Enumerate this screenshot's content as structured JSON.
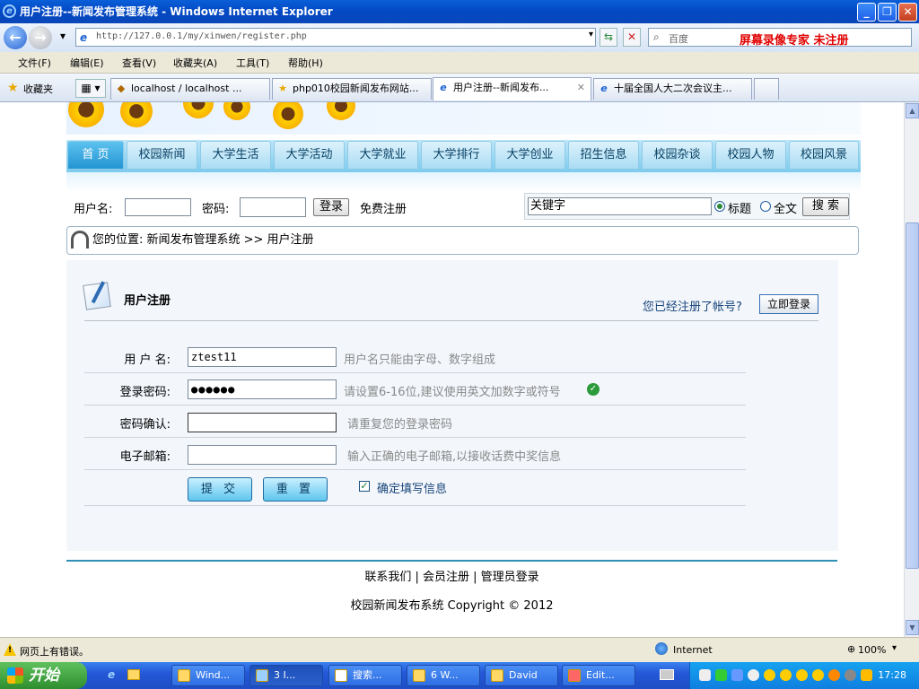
{
  "window": {
    "title": "用户注册--新闻发布管理系统 - Windows Internet Explorer"
  },
  "address": {
    "url": "http://127.0.0.1/my/xinwen/register.php",
    "search_placeholder": "百度",
    "recorder_text": "屏幕录像专家 未注册"
  },
  "menu": [
    "文件(F)",
    "编辑(E)",
    "查看(V)",
    "收藏夹(A)",
    "工具(T)",
    "帮助(H)"
  ],
  "favorites_label": "收藏夹",
  "tabs": [
    {
      "label": "localhost / localhost ..."
    },
    {
      "label": "php010校园新闻发布网站..."
    },
    {
      "label": "用户注册--新闻发布..."
    },
    {
      "label": "十届全国人大二次会议主..."
    }
  ],
  "nav": [
    "首 页",
    "校园新闻",
    "大学生活",
    "大学活动",
    "大学就业",
    "大学排行",
    "大学创业",
    "招生信息",
    "校园杂谈",
    "校园人物",
    "校园风景"
  ],
  "login_bar": {
    "username_label": "用户名:",
    "password_label": "密码:",
    "login_button": "登录",
    "register_link": "免费注册",
    "keyword_value": "关键字",
    "radio_title": "标题",
    "radio_full": "全文",
    "search_button": "搜 索"
  },
  "breadcrumb": "您的位置: 新闻发布管理系统 >> 用户注册",
  "register": {
    "title": "用户注册",
    "already": "您已经注册了帐号?",
    "login_now": "立即登录",
    "fields": [
      {
        "label": "用 户 名:",
        "value": "ztest11",
        "hint": "用户名只能由字母、数字组成"
      },
      {
        "label": "登录密码:",
        "value": "●●●●●●",
        "hint": "请设置6-16位,建议使用英文加数字或符号"
      },
      {
        "label": "密码确认:",
        "value": "",
        "hint": "请重复您的登录密码"
      },
      {
        "label": "电子邮箱:",
        "value": "",
        "hint": "输入正确的电子邮箱,以接收话费中奖信息"
      }
    ],
    "submit": "提 交",
    "reset": "重 置",
    "confirm_label": "确定填写信息"
  },
  "footer": {
    "links": "联系我们 | 会员注册 | 管理员登录",
    "copyright": "校园新闻发布系统 Copyright © 2012"
  },
  "status": {
    "message": "网页上有错误。",
    "zone": "Internet",
    "zoom": "100%"
  },
  "taskbar": {
    "start": "开始",
    "tasks": [
      "Wind...",
      "3 I...",
      "搜索...",
      "6 W...",
      "David",
      "Edit..."
    ],
    "clock": "17:28"
  }
}
